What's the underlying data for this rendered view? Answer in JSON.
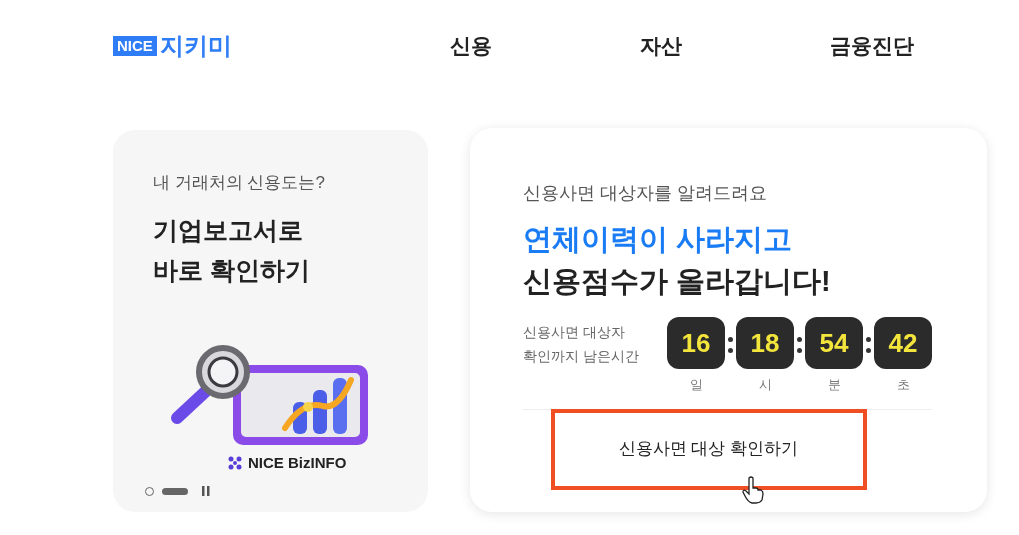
{
  "header": {
    "logo_badge": "NICE",
    "logo_text": "지키미",
    "nav": [
      {
        "label": "신용"
      },
      {
        "label": "자산"
      },
      {
        "label": "금융진단"
      }
    ]
  },
  "promo_card": {
    "subtitle": "내 거래처의 신용도는?",
    "title_lines": [
      "기업보고서로",
      "바로 확인하기"
    ],
    "brand": "NICE BizINFO",
    "slides": [
      {
        "selected": false
      },
      {
        "selected": true
      }
    ]
  },
  "countdown_card": {
    "subtitle": "신용사면 대상자를 알려드려요",
    "highlight": "연체이력이 사라지고",
    "headline": "신용점수가 올라갑니다!",
    "timer_label_lines": [
      "신용사면 대상자",
      "확인까지 남은시간"
    ],
    "units": [
      {
        "value": "16",
        "label": "일"
      },
      {
        "value": "18",
        "label": "시"
      },
      {
        "value": "54",
        "label": "분"
      },
      {
        "value": "42",
        "label": "초"
      }
    ],
    "action": "신용사면 대상 확인하기",
    "action_highlighted": true
  }
}
